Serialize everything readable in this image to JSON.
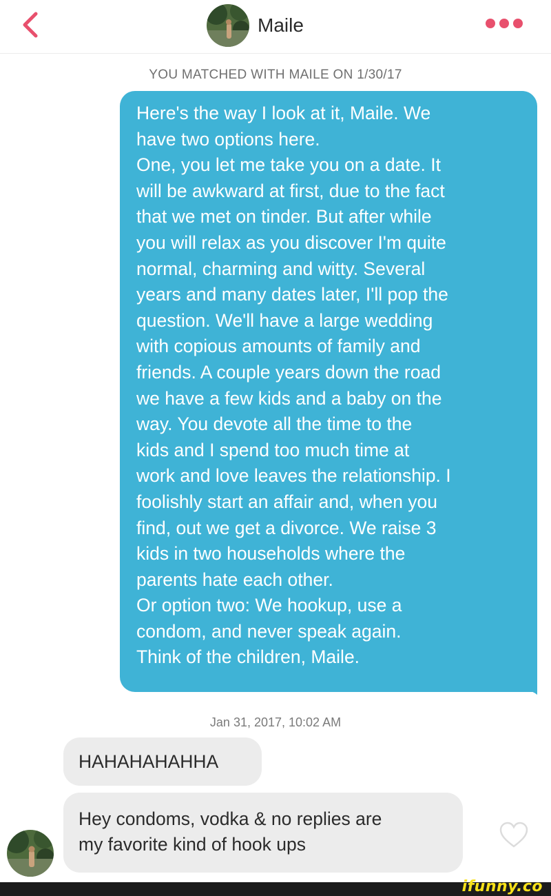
{
  "header": {
    "contact_name": "Maile",
    "icons": {
      "back": "chevron-left-icon",
      "more": "more-options-icon"
    },
    "colors": {
      "back": "#e8506d",
      "more": "#e8506d"
    }
  },
  "match_note": "YOU MATCHED WITH MAILE ON 1/30/17",
  "messages": [
    {
      "direction": "outgoing",
      "text": "Here's the way I look at it, Maile. We\nhave two options here.\nOne, you let me take you on a date. It\nwill be awkward at first, due to the fact\nthat we met on tinder. But after while\nyou will relax as you discover I'm quite\nnormal, charming and witty. Several\nyears and many dates later, I'll pop the\nquestion. We'll have a large wedding\nwith copious amounts of family and\nfriends. A couple years down the road\nwe have a few kids and a baby on the\nway. You devote all the time to the\nkids and I spend too much time at\nwork and love leaves the relationship. I\nfoolishly start an affair and, when you\nfind, out we get a divorce. We raise 3\nkids in two households where the\nparents hate each other.\nOr option two: We hookup, use a\ncondom, and never speak again.\nThink of the children, Maile."
    },
    {
      "direction": "incoming",
      "text": "HAHAHAHAHHA"
    },
    {
      "direction": "incoming",
      "text": "Hey condoms, vodka & no replies are\nmy favorite kind of hook ups"
    }
  ],
  "timestamp": "Jan 31, 2017, 10:02 AM",
  "like_icon": "heart-outline-icon",
  "colors": {
    "outgoing_bubble": "#3fb3d6",
    "incoming_bubble": "#ececec",
    "watermark": "#f7e11a"
  },
  "watermark": "ifunny.co"
}
